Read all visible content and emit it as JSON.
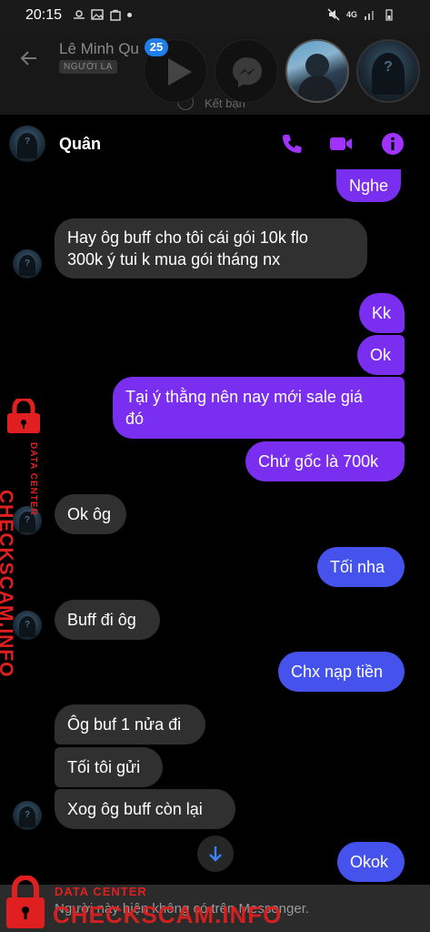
{
  "status_bar": {
    "time": "20:15",
    "network": "4G"
  },
  "background_header": {
    "contact_name": "Lê Minh Qu",
    "tag": "NGƯỜI LẠ",
    "subtitle": "Kết bạn"
  },
  "chat_heads": {
    "badge_count": "25"
  },
  "chat": {
    "contact_name": "Quân",
    "accent_color": "#a033ff",
    "messages": [
      {
        "dir": "out",
        "text": "Nghe"
      },
      {
        "dir": "in",
        "lines": [
          "Hay ôg buff cho tôi cái gói 10k flo",
          "300k ý tui k mua gói tháng nx"
        ]
      },
      {
        "dir": "out",
        "text": "Kk"
      },
      {
        "dir": "out",
        "text": "Ok"
      },
      {
        "dir": "out",
        "lines": [
          "Tại ý thằng nên nay mới sale giá",
          "đó"
        ]
      },
      {
        "dir": "out",
        "text": "Chứ gốc là 700k"
      },
      {
        "dir": "in",
        "text": "Ok ôg"
      },
      {
        "dir": "out",
        "text": "Tối nha"
      },
      {
        "dir": "in",
        "text": "Buff đi ôg"
      },
      {
        "dir": "out",
        "text": "Chx nạp tiền"
      },
      {
        "dir": "in",
        "text": "Ôg buf 1 nửa đi"
      },
      {
        "dir": "in",
        "text": "Tối tôi gửi"
      },
      {
        "dir": "in",
        "text": "Xog ôg buff còn lại"
      },
      {
        "dir": "out",
        "text": "Okok"
      }
    ]
  },
  "footer": {
    "notice": "Người này hiện không có trên Messenger."
  },
  "watermark": {
    "title": "CHECKSCAM.INFO",
    "subtitle": "DATA CENTER"
  }
}
